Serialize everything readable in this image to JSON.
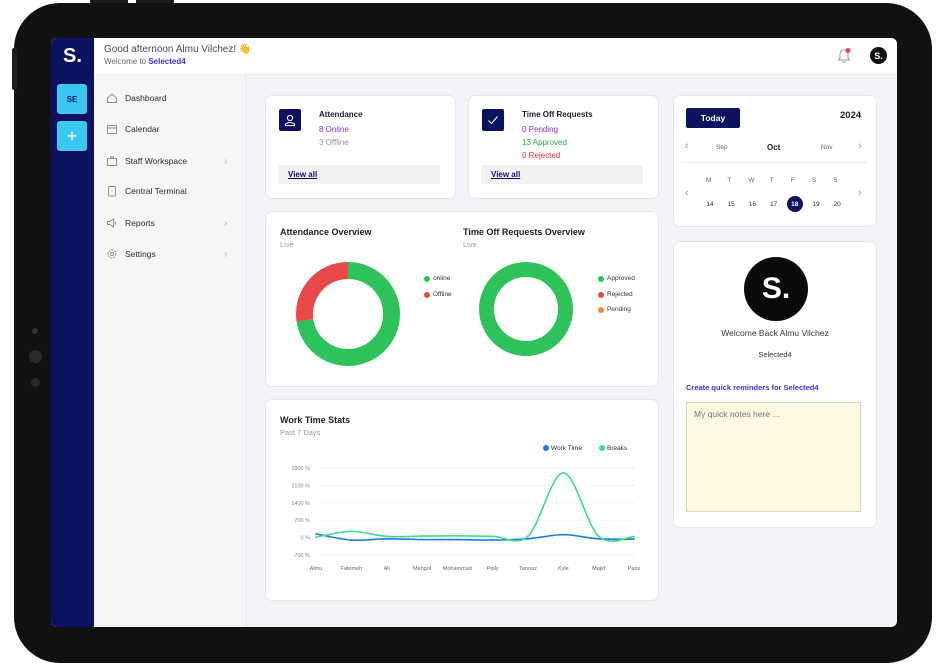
{
  "header": {
    "brand": "S.",
    "greeting": "Good afternoon Almu Vilchez!",
    "wave": "👋",
    "welcome_prefix": "Welcome to",
    "org": "Selected4",
    "avatar": "S."
  },
  "rail": {
    "org_initials": "SE",
    "add_label": "+"
  },
  "sidebar": {
    "items": [
      {
        "label": "Dashboard",
        "icon": "home-icon"
      },
      {
        "label": "Calendar",
        "icon": "calendar-icon"
      },
      {
        "label": "Staff Workspace",
        "icon": "briefcase-icon",
        "chevron": "›"
      },
      {
        "label": "Central Terminal",
        "icon": "tablet-icon"
      },
      {
        "label": "Reports",
        "icon": "megaphone-icon",
        "chevron": "›"
      },
      {
        "label": "Settings",
        "icon": "gear-icon",
        "chevron": "›"
      }
    ]
  },
  "attendance_card": {
    "title": "Attendance",
    "online": "8 Online",
    "offline": "3 Offline",
    "link": "View all"
  },
  "timeoff_card": {
    "title": "Time Off Requests",
    "pending": "0 Pending",
    "approved": "13 Approved",
    "rejected": "0 Rejected",
    "link": "View all"
  },
  "overview": {
    "attendance_title": "Attendance Overview",
    "attendance_sub": "Live",
    "timeoff_title": "Time Off Requests Overview",
    "timeoff_sub": "Live",
    "attendance_legend": [
      "online",
      "Offline"
    ],
    "timeoff_legend": [
      "Approved",
      "Rejected",
      "Pending"
    ]
  },
  "work_stats": {
    "title": "Work Time Stats",
    "sub": "Past 7 Days"
  },
  "calendar": {
    "today_label": "Today",
    "year": "2024",
    "months": [
      "Sep",
      "Oct",
      "Nov"
    ],
    "weekdays": [
      "M",
      "T",
      "W",
      "T",
      "F",
      "S",
      "S"
    ],
    "days": [
      "14",
      "15",
      "16",
      "17",
      "18",
      "19",
      "20"
    ],
    "selected_day": "18"
  },
  "profile": {
    "logo": "S.",
    "welcome": "Welcome Back Almu Vilchez",
    "org": "Selected4",
    "reminder_link": "Create quick reminders for Selected4",
    "notes_placeholder": "My quick notes here ..."
  },
  "colors": {
    "navy": "#0b1361",
    "cyan": "#39c8ef",
    "green": "#2ec35a",
    "red": "#e84848",
    "orange": "#f08c2c",
    "purple": "#8a2be2",
    "blue_line": "#1e7be0",
    "green_line": "#3cdc8c"
  },
  "chart_data": [
    {
      "type": "pie",
      "title": "Attendance Overview",
      "categories": [
        "online",
        "Offline"
      ],
      "values": [
        8,
        3
      ],
      "colors": [
        "#2ec35a",
        "#e84848"
      ]
    },
    {
      "type": "pie",
      "title": "Time Off Requests Overview",
      "categories": [
        "Approved",
        "Rejected",
        "Pending"
      ],
      "values": [
        13,
        0,
        0
      ],
      "colors": [
        "#2ec35a",
        "#e84848",
        "#f08c2c"
      ]
    },
    {
      "type": "line",
      "title": "Work Time Stats",
      "categories": [
        "Almu",
        "Fatemeh",
        "Ali",
        "Mahgol",
        "Mohammad",
        "Polly",
        "Tannaz",
        "Kyle",
        "Majid",
        "Paris"
      ],
      "yticks": [
        "2800 %",
        "2100 %",
        "1400 %",
        "700 %",
        "0 %",
        "-700 %"
      ],
      "ylim": [
        -700,
        2800
      ],
      "series": [
        {
          "name": "Work Time",
          "color": "#1e7be0",
          "values": [
            150,
            -100,
            -50,
            -80,
            -80,
            -100,
            -50,
            120,
            -50,
            -60
          ]
        },
        {
          "name": "Breaks",
          "color": "#3cdc8c",
          "values": [
            20,
            250,
            50,
            60,
            70,
            50,
            60,
            2600,
            50,
            40
          ]
        }
      ]
    }
  ]
}
